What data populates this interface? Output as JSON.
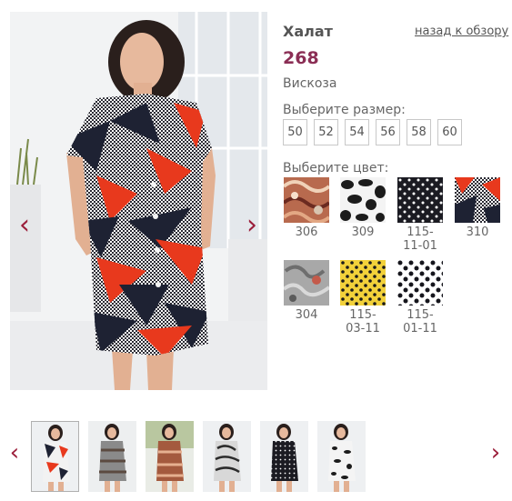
{
  "product": {
    "title": "Халат",
    "price": "268",
    "material": "Вискоза",
    "back_link": "назад к обзору"
  },
  "sizes": {
    "heading": "Выберите размер:",
    "options": [
      "50",
      "52",
      "54",
      "56",
      "58",
      "60"
    ]
  },
  "colors": {
    "heading": "Выберите цвет:",
    "options": [
      {
        "code": "306",
        "swatch": "paisley-red"
      },
      {
        "code": "309",
        "swatch": "black-white-animal"
      },
      {
        "code": "115-\n11-01",
        "swatch": "black-white-dots"
      },
      {
        "code": "310",
        "swatch": "black-red-geometric"
      },
      {
        "code": "304",
        "swatch": "grey-paisley"
      },
      {
        "code": "115-\n03-11",
        "swatch": "yellow-black-dots"
      },
      {
        "code": "115-\n01-11",
        "swatch": "white-black-dots"
      }
    ]
  },
  "gallery": {
    "prev_icon": "‹",
    "next_icon": "›",
    "thumbnail_count": 6,
    "active_thumbnail": 0
  },
  "palette": {
    "price": "#8b2e55",
    "arrow": "#9b1e3a",
    "dress_red": "#e8391d",
    "dress_navy": "#1e2233"
  }
}
